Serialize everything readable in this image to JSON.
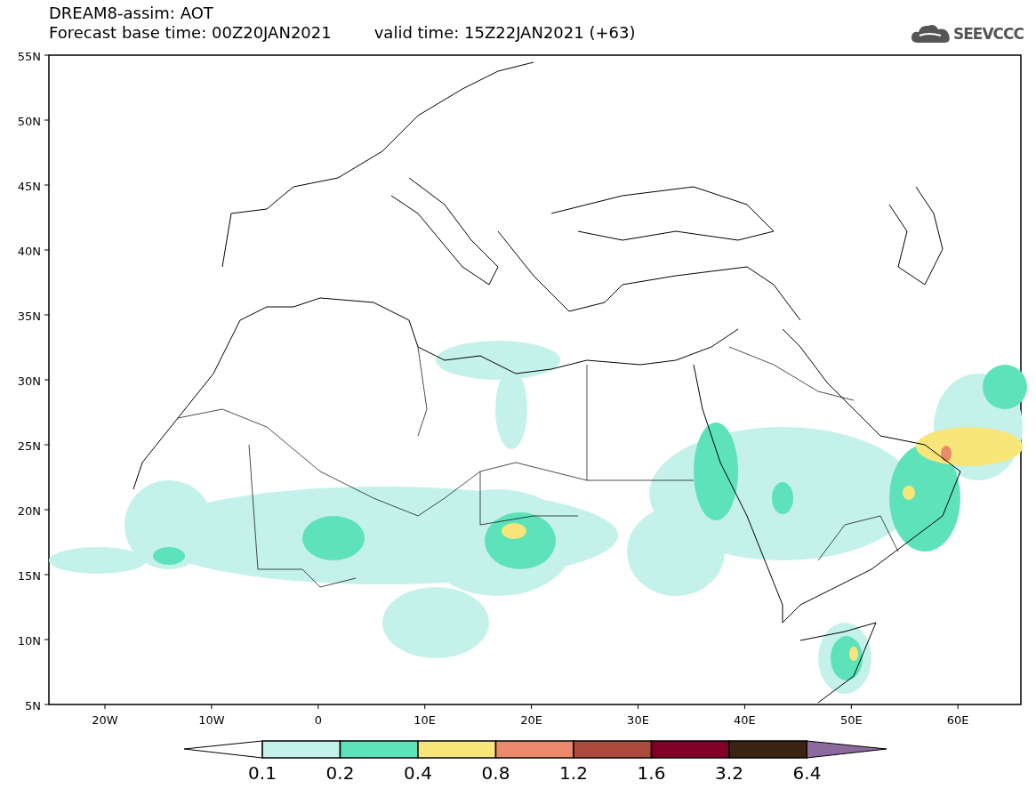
{
  "title": {
    "line_1": "DREAM8-assim: AOT",
    "base_time": "Forecast base time: 00Z20JAN2021",
    "valid_time": "valid time: 15Z22JAN2021 (+63)"
  },
  "logo": {
    "text": "SEEVCCC"
  },
  "map": {
    "y_labels": [
      "55N",
      "50N",
      "45N",
      "40N",
      "35N",
      "30N",
      "25N",
      "20N",
      "15N",
      "10N",
      "5N"
    ],
    "x_labels": [
      "20W",
      "10W",
      "0",
      "10E",
      "20E",
      "30E",
      "40E",
      "50E",
      "60E"
    ]
  },
  "colorbar": {
    "segments": [
      {
        "kind": "lower_arrow",
        "color": "#ffffff"
      },
      {
        "kind": "bin",
        "color": "#c4f2ea"
      },
      {
        "kind": "bin",
        "color": "#5ee2b9"
      },
      {
        "kind": "bin",
        "color": "#f8e67a"
      },
      {
        "kind": "bin",
        "color": "#ea8a6a"
      },
      {
        "kind": "bin",
        "color": "#ad4a40"
      },
      {
        "kind": "bin",
        "color": "#820028"
      },
      {
        "kind": "bin",
        "color": "#3b2412"
      },
      {
        "kind": "upper_arrow",
        "color": "#8c6a9e"
      }
    ],
    "labels": [
      "0.1",
      "0.2",
      "0.4",
      "0.8",
      "1.2",
      "1.6",
      "3.2",
      "6.4"
    ]
  }
}
